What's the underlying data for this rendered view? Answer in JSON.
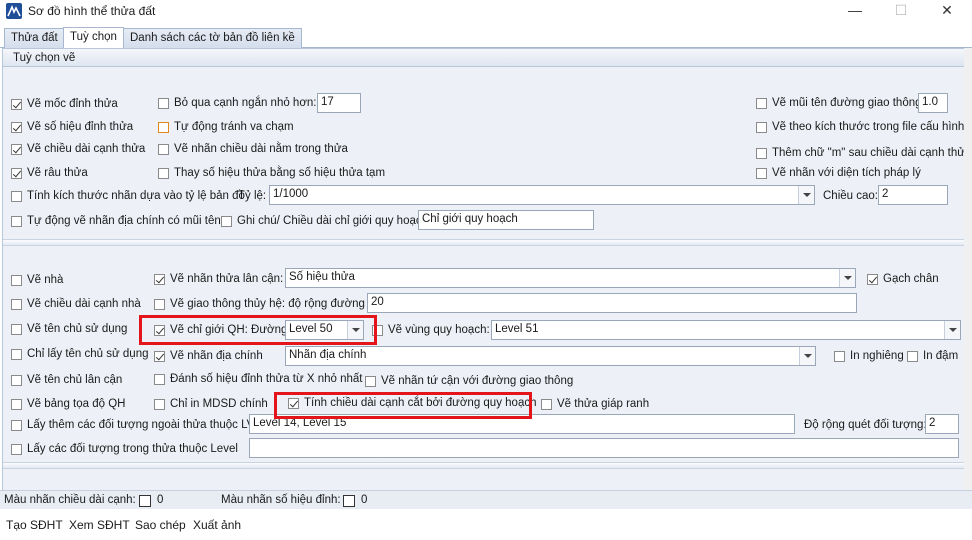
{
  "window": {
    "title": "Sơ đồ hình thể thửa đất",
    "minimize": "—",
    "maximize": "☐",
    "close": "✕"
  },
  "tabs": [
    "Thửa đất",
    "Tuỳ chọn",
    "Danh sách các tờ bản đồ liên kề"
  ],
  "section1": {
    "header": "Tuỳ chọn vẽ",
    "col1": [
      {
        "label": "Vẽ mốc đỉnh thửa",
        "checked": true
      },
      {
        "label": "Vẽ số hiệu đỉnh thửa",
        "checked": true
      },
      {
        "label": "Vẽ chiều dài cạnh thửa",
        "checked": true
      },
      {
        "label": "Vẽ râu thửa",
        "checked": true
      },
      {
        "label": "Tính kích thước nhãn dựa vào tỷ lệ bản đồ",
        "checked": false
      },
      {
        "label": "Tự động vẽ nhãn địa chính có mũi tên",
        "checked": false
      }
    ],
    "col2": [
      {
        "label": "Bỏ qua cạnh ngắn nhỏ hơn:",
        "checked": false
      },
      {
        "label": "Tự động tránh va chạm",
        "checked": false
      },
      {
        "label": "Vẽ nhãn chiều dài nằm trong thửa",
        "checked": false
      },
      {
        "label": "Thay số hiệu thửa bằng số hiệu thửa tạm",
        "checked": false
      },
      {
        "label": "Ghi chú/ Chiều dài chỉ giới quy hoạch",
        "checked": false
      }
    ],
    "col3": [
      {
        "label": "Vẽ mũi tên đường giao thông",
        "checked": false
      },
      {
        "label": "Vẽ theo kích thước trong file cấu hình",
        "checked": false
      },
      {
        "label": "Thêm chữ  \"m\" sau chiều dài cạnh thửa",
        "checked": false
      },
      {
        "label": "Vẽ nhãn với diện tích pháp lý",
        "checked": false
      }
    ],
    "skip_short_value": "17",
    "arrow_value": "1.0",
    "scale_label": "Tỷ lệ:",
    "scale_value": "1/1000",
    "height_label": "Chiều cao:",
    "height_value": "2",
    "note_value": "Chỉ giới quy hoạch"
  },
  "section2": {
    "col1": [
      {
        "label": "Vẽ nhà",
        "checked": false
      },
      {
        "label": "Vẽ chiều dài cạnh nhà",
        "checked": false
      },
      {
        "label": "Vẽ tên chủ sử dụng",
        "checked": false
      },
      {
        "label": "Chỉ lấy tên chủ sử dụng",
        "checked": false
      },
      {
        "label": "Vẽ tên chủ lân cận",
        "checked": false
      },
      {
        "label": "Vẽ bảng tọa độ QH",
        "checked": false
      },
      {
        "label": "Lấy thêm các đối tượng ngoài thửa thuộc LV:",
        "checked": false
      },
      {
        "label": "Lấy các đối tượng trong thửa thuộc Level",
        "checked": false
      }
    ],
    "neighbor_label": "Vẽ nhãn thửa lân cận:",
    "neighbor_checked": true,
    "neighbor_value": "Số hiệu thửa",
    "underline_label": "Gạch chân",
    "underline_checked": true,
    "water_label": "Vẽ giao thông thủy hệ: độ rộng đường",
    "water_checked": false,
    "water_value": "20",
    "qh_label": "Vẽ chỉ giới QH: Đường",
    "qh_checked": true,
    "qh_value": "Level 50",
    "zone_label": "Vẽ vùng quy hoạch:",
    "zone_checked": false,
    "zone_value": "Level 51",
    "cadastral_label": "Vẽ nhãn địa chính",
    "cadastral_checked": true,
    "cadastral_value": "Nhãn địa chính",
    "italic_label": "In nghiêng",
    "italic_checked": false,
    "bold_label": "In đậm",
    "bold_checked": false,
    "renumber_label": "Đánh số hiệu đỉnh thửa từ X nhỏ nhất",
    "renumber_checked": false,
    "adjacent_label": "Vẽ nhãn tứ cận với đường giao thông",
    "adjacent_checked": false,
    "mdsd_label": "Chỉ in MDSD chính",
    "mdsd_checked": false,
    "cut_label": "Tính chiều dài cạnh cắt bởi đường quy hoạch",
    "cut_checked": true,
    "border_label": "Vẽ thửa giáp ranh",
    "border_checked": false,
    "outside_levels_value": "Level 14, Level 15",
    "sweep_label": "Độ rộng quét đối tượng:",
    "sweep_value": "2",
    "inside_levels_value": ""
  },
  "status": {
    "edge_color_label": "Màu nhãn chiều dài cạnh:",
    "edge_color_value": "0",
    "vertex_color_label": "Màu nhãn số hiệu đỉnh:",
    "vertex_color_value": "0"
  },
  "bottom_menu": [
    "Tạo SĐHT",
    "Xem SĐHT",
    "Sao chép",
    "Xuất ảnh"
  ]
}
